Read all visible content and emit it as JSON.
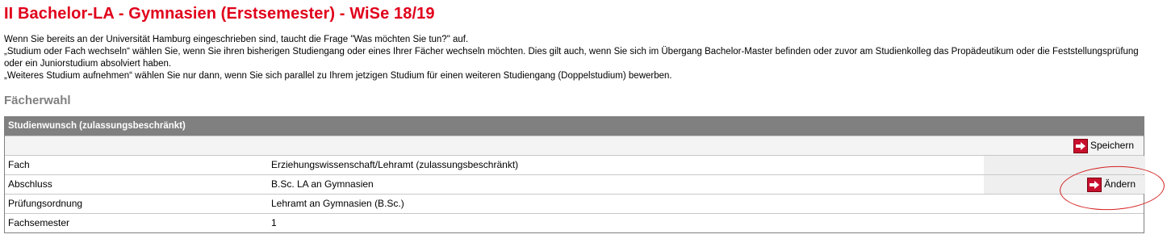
{
  "page": {
    "title": "II Bachelor-LA - Gymnasien (Erstsemester) - WiSe 18/19"
  },
  "intro": {
    "line1": "Wenn Sie bereits an der Universität Hamburg eingeschrieben sind, taucht die Frage \"Was möchten Sie tun?\" auf.",
    "line2": "„Studium oder Fach wechseln“ wählen Sie, wenn Sie ihren bisherigen Studiengang oder eines Ihrer Fächer wechseln möchten. Dies gilt auch, wenn Sie sich im Übergang Bachelor-Master befinden oder zuvor am Studienkolleg das Propädeutikum oder die Feststellungsprüfung oder ein Juniorstudium absolviert haben.",
    "line3": "„Weiteres Studium aufnehmen“ wählen Sie nur dann, wenn Sie sich parallel zu Ihrem jetzigen Studium für einen weiteren Studiengang (Doppelstudium) bewerben."
  },
  "section": {
    "heading": "Fächerwahl"
  },
  "panel": {
    "header": "Studienwunsch (zulassungsbeschränkt)",
    "save_label": "Speichern",
    "rows": [
      {
        "label": "Fach",
        "value": "Erziehungswissenschaft/Lehramt (zulassungsbeschränkt)"
      },
      {
        "label": "Abschluss",
        "value": "B.Sc. LA an Gymnasien",
        "action": "Ändern"
      },
      {
        "label": "Prüfungsordnung",
        "value": "Lehramt an Gymnasien (B.Sc.)"
      },
      {
        "label": "Fachsemester",
        "value": "1"
      }
    ]
  },
  "icons": {
    "button_icon": "arrow-right-icon",
    "button_icon_color": "#c8102e"
  },
  "colors": {
    "title": "#e0001b",
    "panel_header_bg": "#808080",
    "highlight": "#d42020"
  }
}
